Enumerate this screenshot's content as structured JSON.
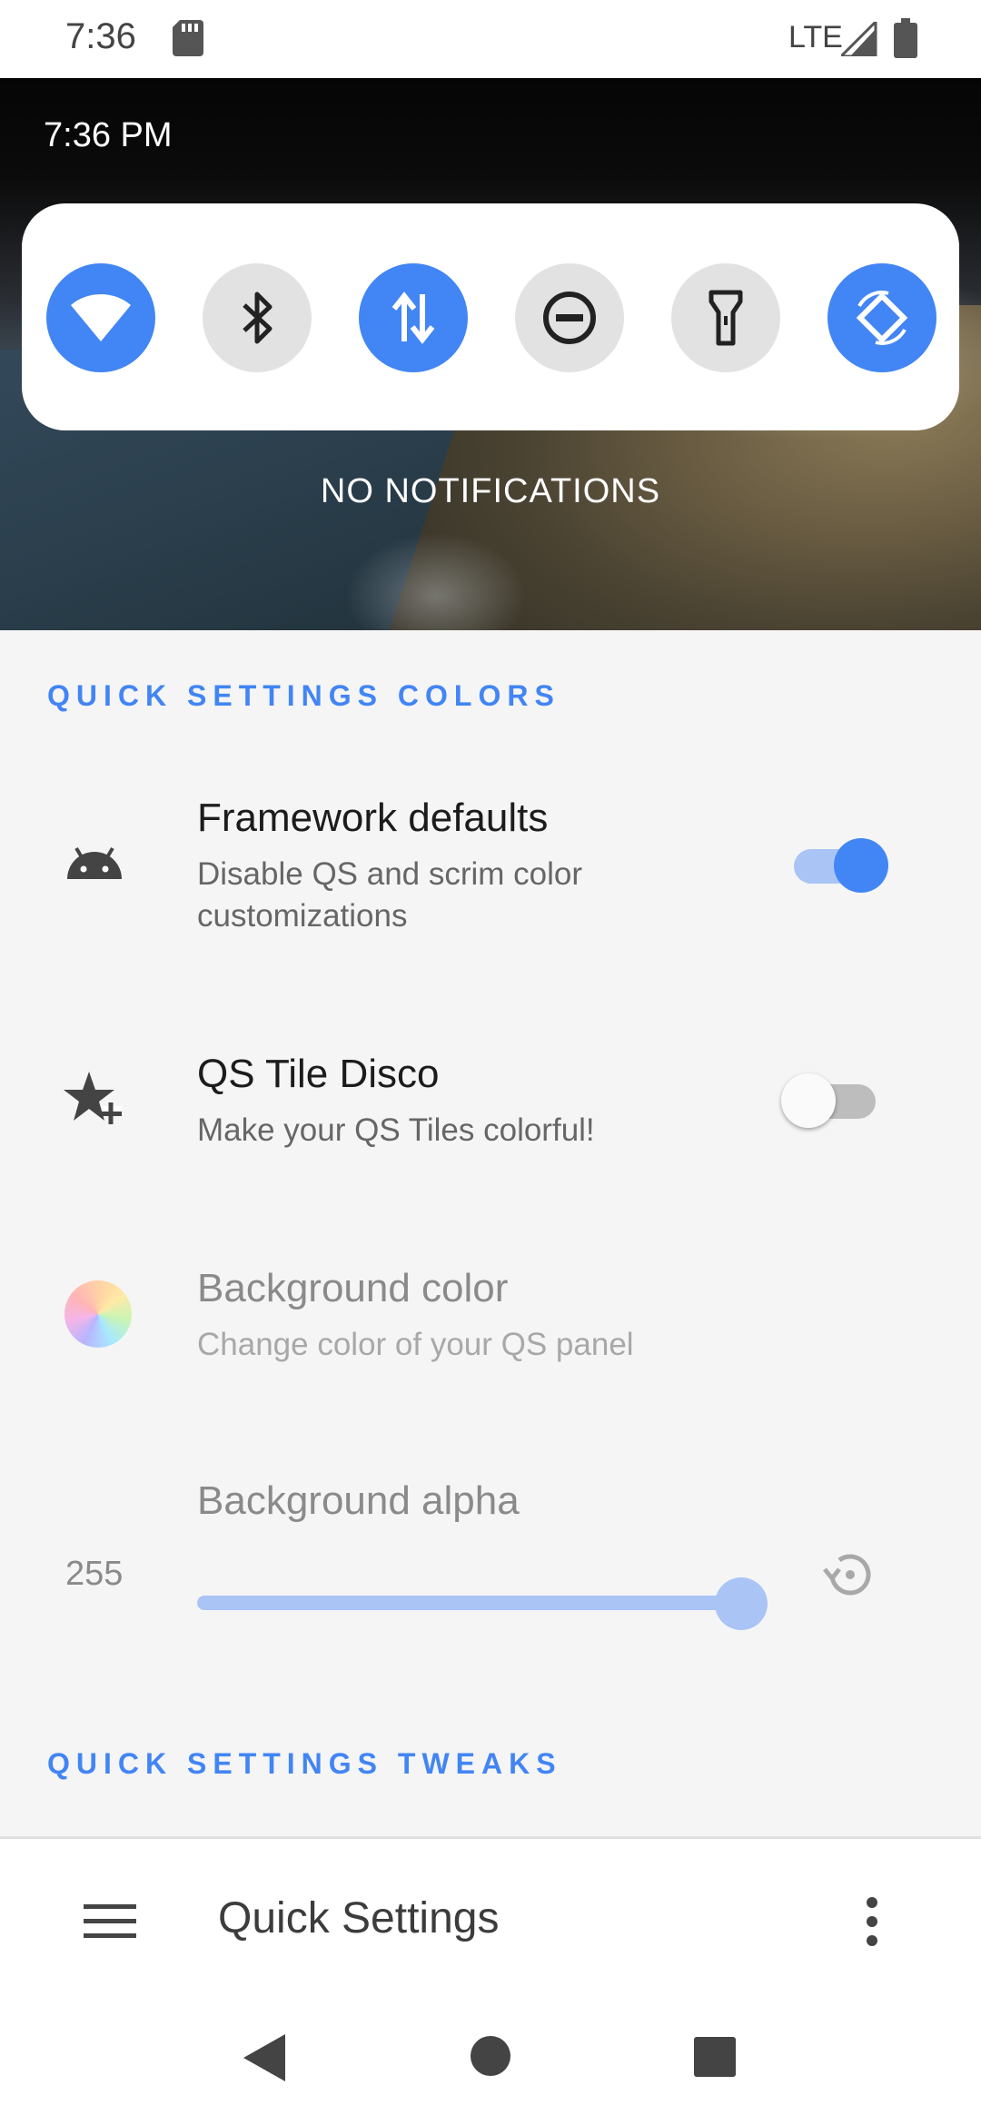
{
  "status_bar": {
    "time": "7:36",
    "network": "LTE"
  },
  "shade": {
    "clock": "7:36 PM",
    "tiles": [
      {
        "name": "wifi",
        "icon": "wifi-icon",
        "on": true
      },
      {
        "name": "bluetooth",
        "icon": "bluetooth-icon",
        "on": false
      },
      {
        "name": "mobile-data",
        "icon": "data-arrows-icon",
        "on": true
      },
      {
        "name": "do-not-disturb",
        "icon": "dnd-icon",
        "on": false
      },
      {
        "name": "flashlight",
        "icon": "flashlight-icon",
        "on": false
      },
      {
        "name": "auto-rotate",
        "icon": "rotate-icon",
        "on": true
      }
    ],
    "notifications_text": "NO NOTIFICATIONS"
  },
  "sections": {
    "colors_header": "QUICK SETTINGS COLORS",
    "tweaks_header": "QUICK SETTINGS TWEAKS"
  },
  "settings": {
    "framework": {
      "title": "Framework defaults",
      "summary": "Disable QS and scrim color customizations",
      "enabled": true
    },
    "disco": {
      "title": "QS Tile Disco",
      "summary": "Make your QS Tiles colorful!",
      "enabled": false
    },
    "bg_color": {
      "title": "Background color",
      "summary": "Change color of your QS panel"
    },
    "bg_alpha": {
      "title": "Background alpha",
      "value": "255",
      "max": 255
    }
  },
  "bottom_bar": {
    "title": "Quick Settings"
  },
  "colors": {
    "accent": "#4285f4",
    "accent_light": "#a9c4f5",
    "tile_off": "#e2e2e2"
  }
}
